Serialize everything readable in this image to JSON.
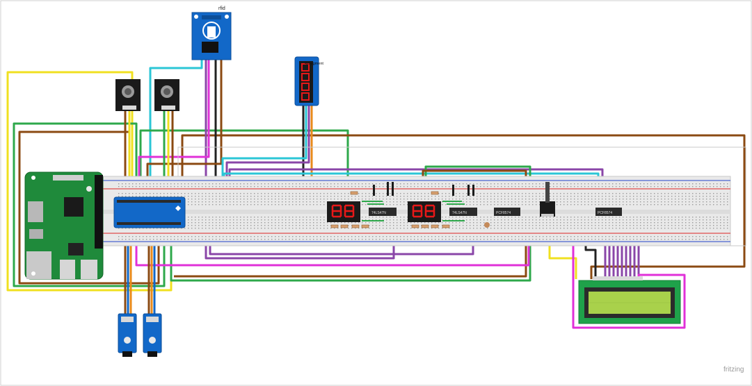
{
  "labels": {
    "rfid": "rfid",
    "tm1637": "4xsegment",
    "ic_1": "74LS47N",
    "ic_2": "74LS47N",
    "ic_3": "PCF8574",
    "ic_4": "PCF8574",
    "brand": "fritzing"
  },
  "colors": {
    "breadboard": "#e8e8e8",
    "rail_red": "#d22",
    "rail_blue": "#2244cc",
    "pi_green": "#1f8a3b",
    "module_blue": "#1268c8",
    "lcd_green": "#a9d14b",
    "wire_yellow": "#f0e020",
    "wire_green": "#2ea84b",
    "wire_brown": "#8b4a12",
    "wire_purple": "#8a46a8",
    "wire_cyan": "#2bc6d6",
    "wire_magenta": "#e030d8",
    "wire_orange": "#e88a1a",
    "wire_black": "#222222",
    "seg_red": "#e81818"
  }
}
